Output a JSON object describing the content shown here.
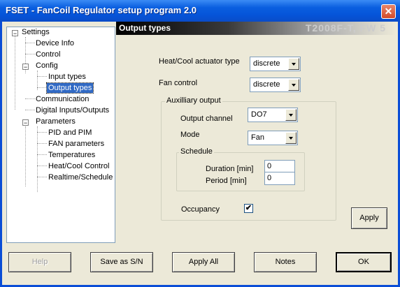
{
  "window": {
    "title": "FSET - FanCoil Regulator setup program 2.0",
    "close_glyph": "✕"
  },
  "tree": {
    "settings": "Settings",
    "device_info": "Device Info",
    "control": "Control",
    "config": "Config",
    "input_types": "Input types",
    "output_types": "Output types",
    "communication": "Communication",
    "digital_io": "Digital Inputs/Outputs",
    "parameters": "Parameters",
    "pid_pim": "PID and PIM",
    "fan_parameters": "FAN parameters",
    "temperatures": "Temperatures",
    "heat_cool_control": "Heat/Cool Control",
    "realtime_schedule": "Realtime/Schedule",
    "expanded_glyph": "−"
  },
  "panel": {
    "title": "Output types",
    "device": "T2008F-T, FW 5"
  },
  "form": {
    "heatcool_label": "Heat/Cool actuator type",
    "heatcool_value": "discrete",
    "fan_label": "Fan control",
    "fan_value": "discrete",
    "aux_group": "Auxilliary output",
    "channel_label": "Output channel",
    "channel_value": "DO7",
    "mode_label": "Mode",
    "mode_value": "Fan",
    "schedule_group": "Schedule",
    "duration_label": "Duration [min]",
    "duration_value": "0",
    "period_label": "Period [min]",
    "period_value": "0",
    "occupancy_label": "Occupancy",
    "occupancy_check": "✔",
    "apply": "Apply"
  },
  "buttons": {
    "help": "Help",
    "save_sn": "Save as S/N",
    "apply_all": "Apply All",
    "notes": "Notes",
    "ok": "OK"
  }
}
